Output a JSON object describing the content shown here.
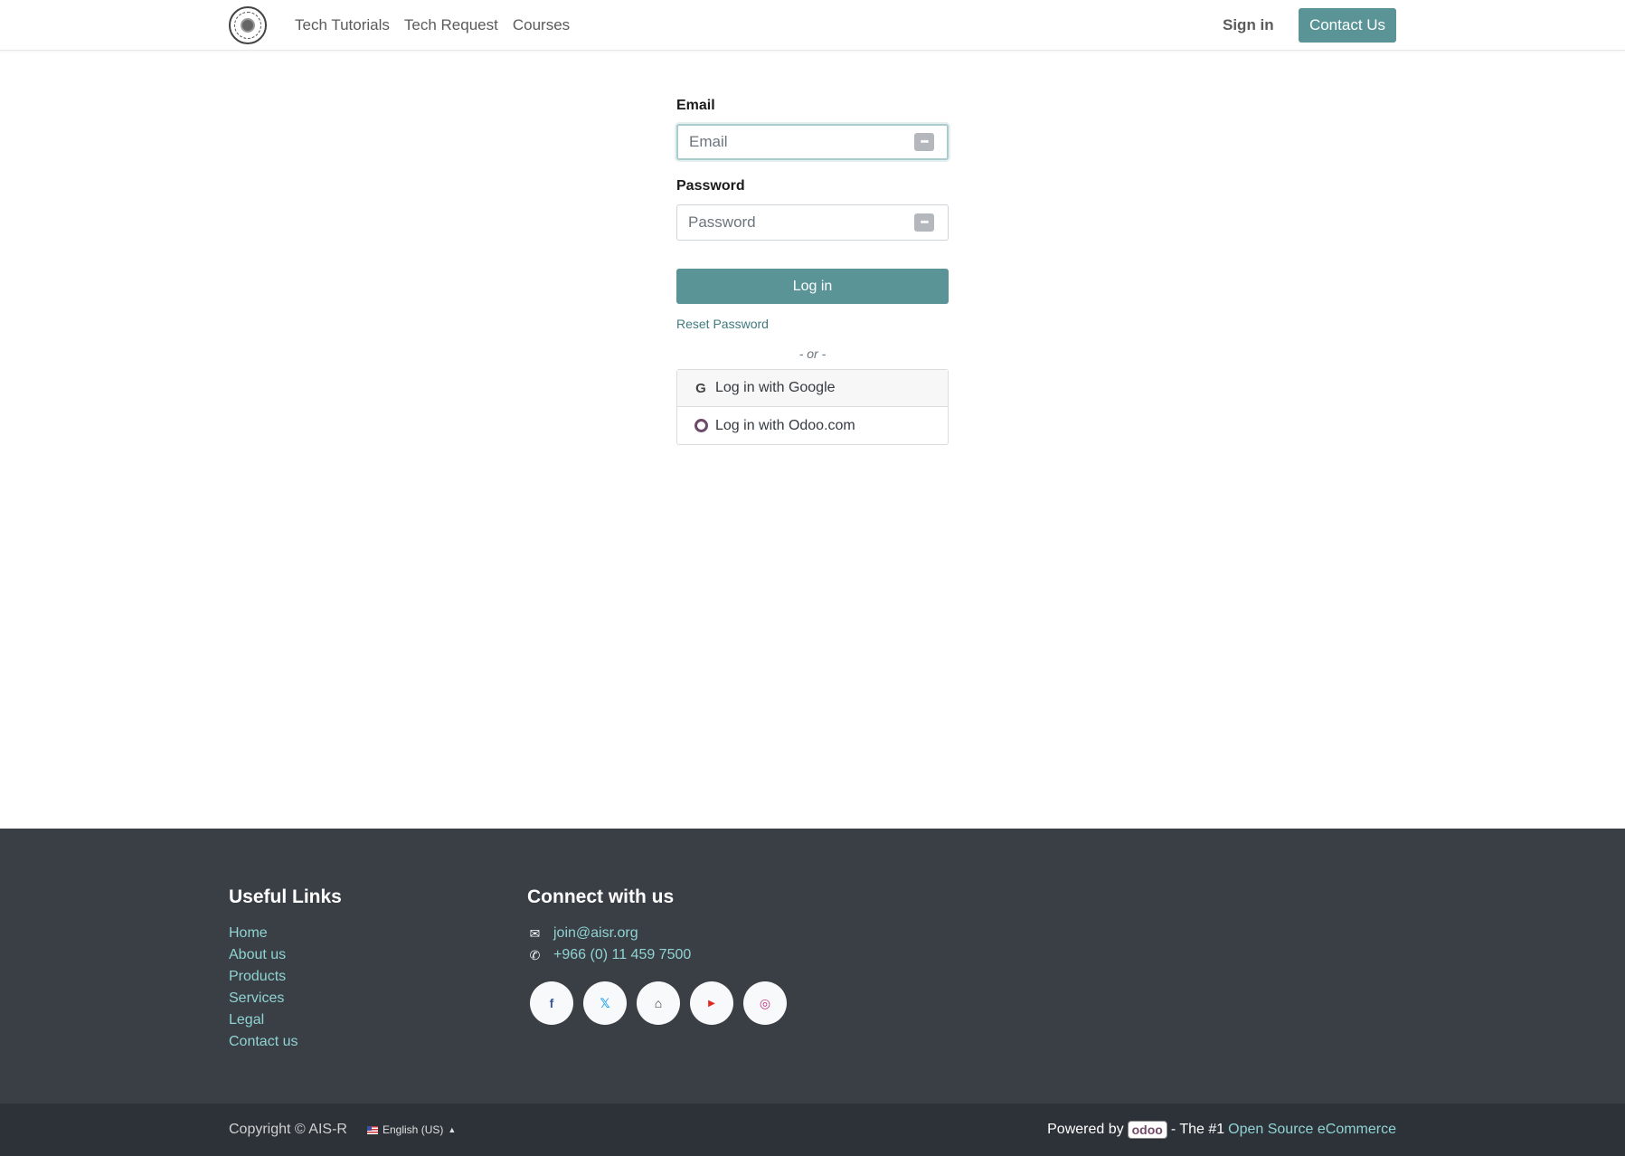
{
  "header": {
    "nav": [
      "Tech Tutorials",
      "Tech Request",
      "Courses"
    ],
    "sign_in": "Sign in",
    "contact_us": "Contact Us"
  },
  "login": {
    "email_label": "Email",
    "email_placeholder": "Email",
    "password_label": "Password",
    "password_placeholder": "Password",
    "login_button": "Log in",
    "reset_password": "Reset Password",
    "or_text": "- or -",
    "google_login": "Log in with Google",
    "odoo_login": "Log in with Odoo.com"
  },
  "footer": {
    "useful_links_title": "Useful Links",
    "useful_links": [
      "Home",
      "About us",
      "Products",
      "Services",
      "Legal",
      "Contact us"
    ],
    "connect_title": "Connect with us",
    "email": "join@aisr.org",
    "phone": "+966 (0) 11 459 7500",
    "socials": [
      "facebook-icon",
      "x-twitter-icon",
      "home-icon",
      "youtube-icon",
      "instagram-icon"
    ]
  },
  "bottom": {
    "copyright": "Copyright © AIS-R",
    "language": "English (US)",
    "powered_by": "Powered by",
    "odoo_logo": "odoo",
    "the_1": "- The #1",
    "ecommerce_link": "Open Source eCommerce"
  },
  "colors": {
    "accent": "#5a9497",
    "footer_bg": "#3a3f46",
    "footer_link": "#8fd3d3"
  }
}
